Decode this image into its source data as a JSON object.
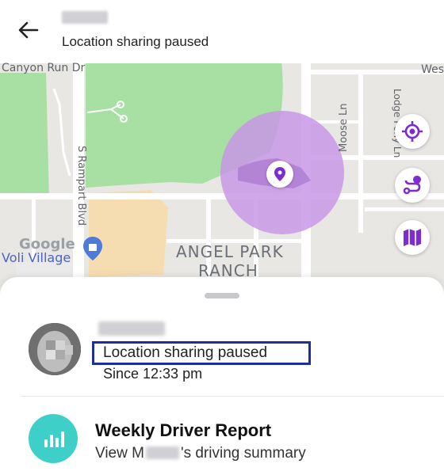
{
  "header": {
    "subtitle": "Location sharing paused"
  },
  "map": {
    "labels": {
      "canyon_run": "Canyon Run Dr",
      "west": "Wes",
      "rampart": "S Rampart Blvd",
      "moose": "Moose Ln",
      "lodge": "Lodge Pony Ln",
      "angel_park": "ANGEL PARK",
      "ranch": "RANCH",
      "google": "Google",
      "village": "Voli Village"
    },
    "colors": {
      "park_green": "#a7dfa3",
      "geofence_purple": "#c996e8",
      "sand": "#f5ddb0",
      "accent_purple": "#7b2dd0"
    }
  },
  "member": {
    "status": "Location sharing paused",
    "since": "Since 12:33 pm"
  },
  "report": {
    "title": "Weekly Driver Report",
    "sub_prefix": "View M",
    "sub_suffix": "'s driving summary"
  },
  "icons": [
    "back-arrow-icon",
    "target-locate-icon",
    "route-icon",
    "map-icon",
    "bar-chart-icon",
    "location-pin-icon"
  ]
}
